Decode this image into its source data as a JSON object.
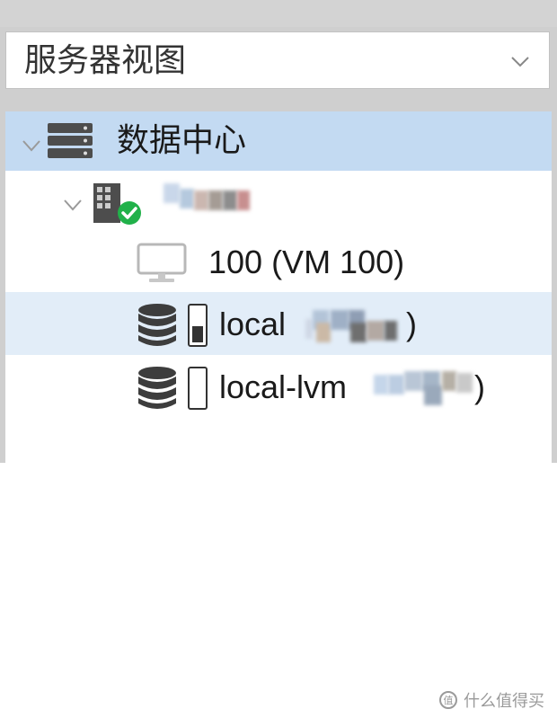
{
  "view_select": {
    "value": "服务器视图"
  },
  "tree": {
    "datacenter": {
      "label": "数据中心"
    },
    "vm": {
      "label": "100 (VM 100)"
    },
    "storage_local": {
      "label": "local",
      "suffix": ")"
    },
    "storage_local_lvm": {
      "label": "local-lvm",
      "suffix": ")"
    }
  },
  "watermark": {
    "text": "什么值得买"
  }
}
